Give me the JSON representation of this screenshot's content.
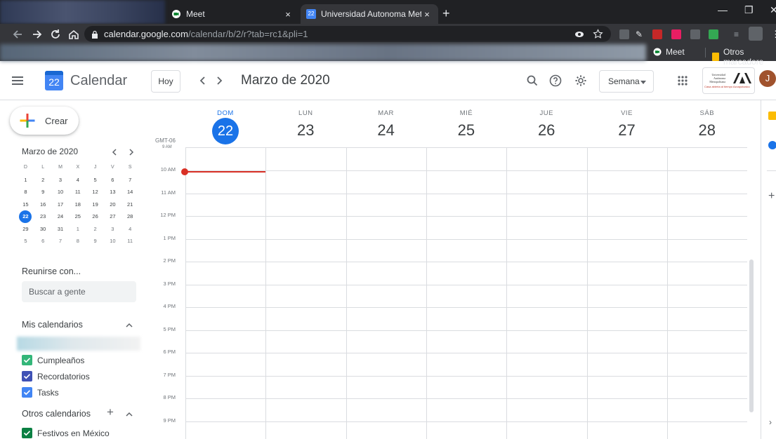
{
  "browser": {
    "tabs": [
      {
        "title": "Meet",
        "active": false,
        "close": "×"
      },
      {
        "title": "Universidad Autonoma Metropol",
        "active": true,
        "close": "×",
        "favicon_day": "22"
      }
    ],
    "new_tab": "+",
    "url": {
      "host": "calendar.google.com",
      "path": "/calendar/b/2/r?tab=rc1&pli=1"
    },
    "bookmarks": [
      {
        "label": "Meet",
        "icon": "meet-icon"
      },
      {
        "label": "Otros marcadore",
        "icon": "folder-icon"
      }
    ],
    "colors": {
      "frame": "#202124",
      "toolbar": "#35363a",
      "text": "#e8eaed"
    }
  },
  "header": {
    "app_name": "Calendar",
    "logo_day": "22",
    "today_label": "Hoy",
    "period_label": "Marzo de 2020",
    "view_label": "Semana",
    "avatar_letter": "J",
    "org_logo_text": "Universidad Autónoma Metropolitana",
    "org_logo_tagline": "Casa abierta al tiempo  Azcapotzalco"
  },
  "sidebar": {
    "create_label": "Crear",
    "mini_calendar": {
      "title": "Marzo de 2020",
      "weekday_headers": [
        "D",
        "L",
        "M",
        "X",
        "J",
        "V",
        "S"
      ],
      "weeks": [
        [
          "1",
          "2",
          "3",
          "4",
          "5",
          "6",
          "7"
        ],
        [
          "8",
          "9",
          "10",
          "11",
          "12",
          "13",
          "14"
        ],
        [
          "15",
          "16",
          "17",
          "18",
          "19",
          "20",
          "21"
        ],
        [
          "22",
          "23",
          "24",
          "25",
          "26",
          "27",
          "28"
        ],
        [
          "29",
          "30",
          "31",
          "1",
          "2",
          "3",
          "4"
        ],
        [
          "5",
          "6",
          "7",
          "8",
          "9",
          "10",
          "11"
        ]
      ],
      "selected": "22"
    },
    "meet_with_label": "Reunirse con...",
    "search_people_placeholder": "Buscar a gente",
    "my_calendars_title": "Mis calendarios",
    "my_calendars": [
      {
        "label": "Cumpleaños",
        "color": "#33b679"
      },
      {
        "label": "Recordatorios",
        "color": "#3f51b5"
      },
      {
        "label": "Tasks",
        "color": "#4285f4"
      }
    ],
    "other_calendars_title": "Otros calendarios",
    "other_calendars": [
      {
        "label": "Festivos en México",
        "color": "#0b8043"
      }
    ]
  },
  "week": {
    "timezone": "GMT-06",
    "timezone_sub": "9 AM",
    "days": [
      {
        "name": "DOM",
        "date": "22",
        "today": true
      },
      {
        "name": "LUN",
        "date": "23"
      },
      {
        "name": "MAR",
        "date": "24"
      },
      {
        "name": "MIÉ",
        "date": "25"
      },
      {
        "name": "JUE",
        "date": "26"
      },
      {
        "name": "VIE",
        "date": "27"
      },
      {
        "name": "SÁB",
        "date": "28"
      }
    ],
    "hours": [
      "10 AM",
      "11 AM",
      "12 PM",
      "1 PM",
      "2 PM",
      "3 PM",
      "4 PM",
      "5 PM",
      "6 PM",
      "7 PM",
      "8 PM",
      "9 PM"
    ]
  },
  "colors": {
    "accent": "#1a73e8",
    "now_line": "#d93025",
    "grid": "#dadce0"
  }
}
